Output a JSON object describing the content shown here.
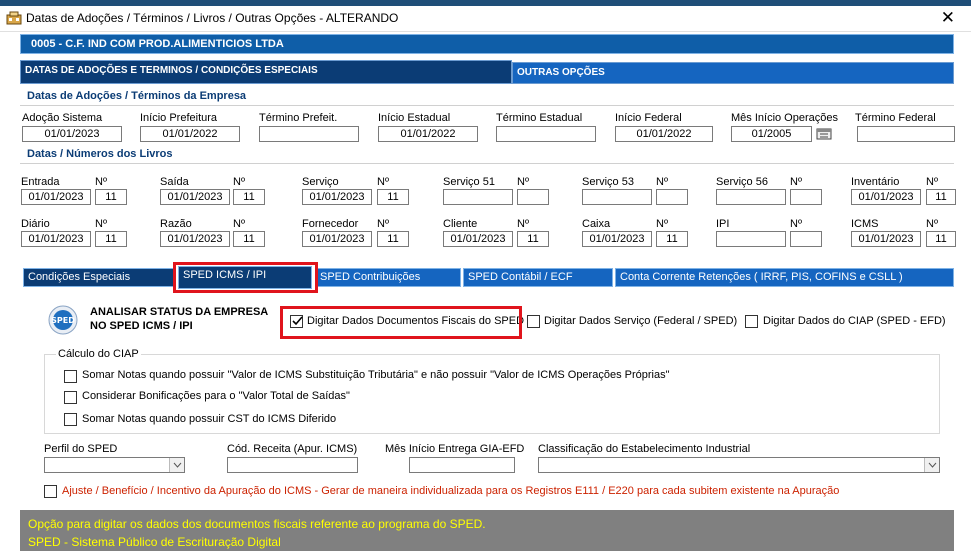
{
  "window": {
    "title": "Datas de Adoções / Términos / Livros / Outras Opções   -   ALTERANDO",
    "close": "✕"
  },
  "company": "0005   -   C.F. IND COM PROD.ALIMENTICIOS LTDA",
  "section_tabs": {
    "tab1": "DATAS DE ADOÇÕES E TERMINOS / CONDIÇÕES ESPECIAIS",
    "tab2": "OUTRAS OPÇÕES"
  },
  "adocoes": {
    "heading": "Datas de Adoções / Términos da Empresa",
    "fields": [
      {
        "label": "Adoção Sistema",
        "value": "01/01/2023"
      },
      {
        "label": "Início Prefeitura",
        "value": "01/01/2022"
      },
      {
        "label": "Término Prefeit.",
        "value": ""
      },
      {
        "label": "Início Estadual",
        "value": "01/01/2022"
      },
      {
        "label": "Término Estadual",
        "value": ""
      },
      {
        "label": "Início Federal",
        "value": "01/01/2022"
      },
      {
        "label": "Mês Início Operações",
        "value": "01/2005"
      },
      {
        "label": "Término Federal",
        "value": ""
      }
    ]
  },
  "livros": {
    "heading": "Datas / Números dos Livros",
    "row1": [
      {
        "label": "Entrada",
        "date": "01/01/2023",
        "num_label": "Nº",
        "num": "11"
      },
      {
        "label": "Saída",
        "date": "01/01/2023",
        "num_label": "Nº",
        "num": "11"
      },
      {
        "label": "Serviço",
        "date": "01/01/2023",
        "num_label": "Nº",
        "num": "11"
      },
      {
        "label": "Serviço 51",
        "date": "",
        "num_label": "Nº",
        "num": ""
      },
      {
        "label": "Serviço 53",
        "date": "",
        "num_label": "Nº",
        "num": ""
      },
      {
        "label": "Serviço 56",
        "date": "",
        "num_label": "Nº",
        "num": ""
      },
      {
        "label": "Inventário",
        "date": "01/01/2023",
        "num_label": "Nº",
        "num": "11"
      }
    ],
    "row2": [
      {
        "label": "Diário",
        "date": "01/01/2023",
        "num_label": "Nº",
        "num": "11"
      },
      {
        "label": "Razão",
        "date": "01/01/2023",
        "num_label": "Nº",
        "num": "11"
      },
      {
        "label": "Fornecedor",
        "date": "01/01/2023",
        "num_label": "Nº",
        "num": "11"
      },
      {
        "label": "Cliente",
        "date": "01/01/2023",
        "num_label": "Nº",
        "num": "11"
      },
      {
        "label": "Caixa",
        "date": "01/01/2023",
        "num_label": "Nº",
        "num": "11"
      },
      {
        "label": "IPI",
        "date": "",
        "num_label": "Nº",
        "num": ""
      },
      {
        "label": "ICMS",
        "date": "01/01/2023",
        "num_label": "Nº",
        "num": "11"
      }
    ]
  },
  "sub_tabs": [
    "Condições Especiais",
    "SPED ICMS / IPI",
    "SPED Contribuições",
    "SPED Contábil / ECF",
    "Conta Corrente Retenções ( IRRF, PIS, COFINS  e  CSLL )"
  ],
  "sped": {
    "analisar_line1": "ANALISAR STATUS DA EMPRESA",
    "analisar_line2": "NO SPED ICMS / IPI",
    "logo_text": "SPED",
    "chk_docs": "Digitar Dados Documentos Fiscais do SPED",
    "chk_servico": "Digitar Dados Serviço (Federal / SPED)",
    "chk_ciap": "Digitar Dados do CIAP (SPED - EFD)",
    "ciap_group": "Cálculo do CIAP",
    "ciap_opt1": "Somar Notas quando possuir \"Valor de ICMS Substituição Tributária\" e não possuir \"Valor de ICMS Operações Próprias\"",
    "ciap_opt2": "Considerar Bonificações para o \"Valor Total de Saídas\"",
    "ciap_opt3": "Somar Notas quando possuir CST do ICMS Diferido",
    "perfil_label": "Perfil do SPED",
    "cod_receita_label": "Cód. Receita (Apur. ICMS)",
    "mes_gia_label": "Mês Início Entrega GIA-EFD",
    "classif_label": "Classificação do Estabelecimento Industrial",
    "ajuste": "Ajuste / Benefício / Incentivo da Apuração do ICMS - Gerar de maneira individualizada para os Registros E111  / E220 para cada subitem existente na Apuração"
  },
  "footer": {
    "line1": "Opção para digitar os dados dos documentos fiscais referente ao programa do SPED.",
    "line2": "SPED - Sistema Público de Escrituração Digital"
  },
  "colors": {
    "highlight": "#e0141c",
    "footer_text": "#ffff00",
    "tab_blue": "#1565c0",
    "dark_blue": "#0b3c75",
    "ajuste_red": "#cc2200"
  }
}
